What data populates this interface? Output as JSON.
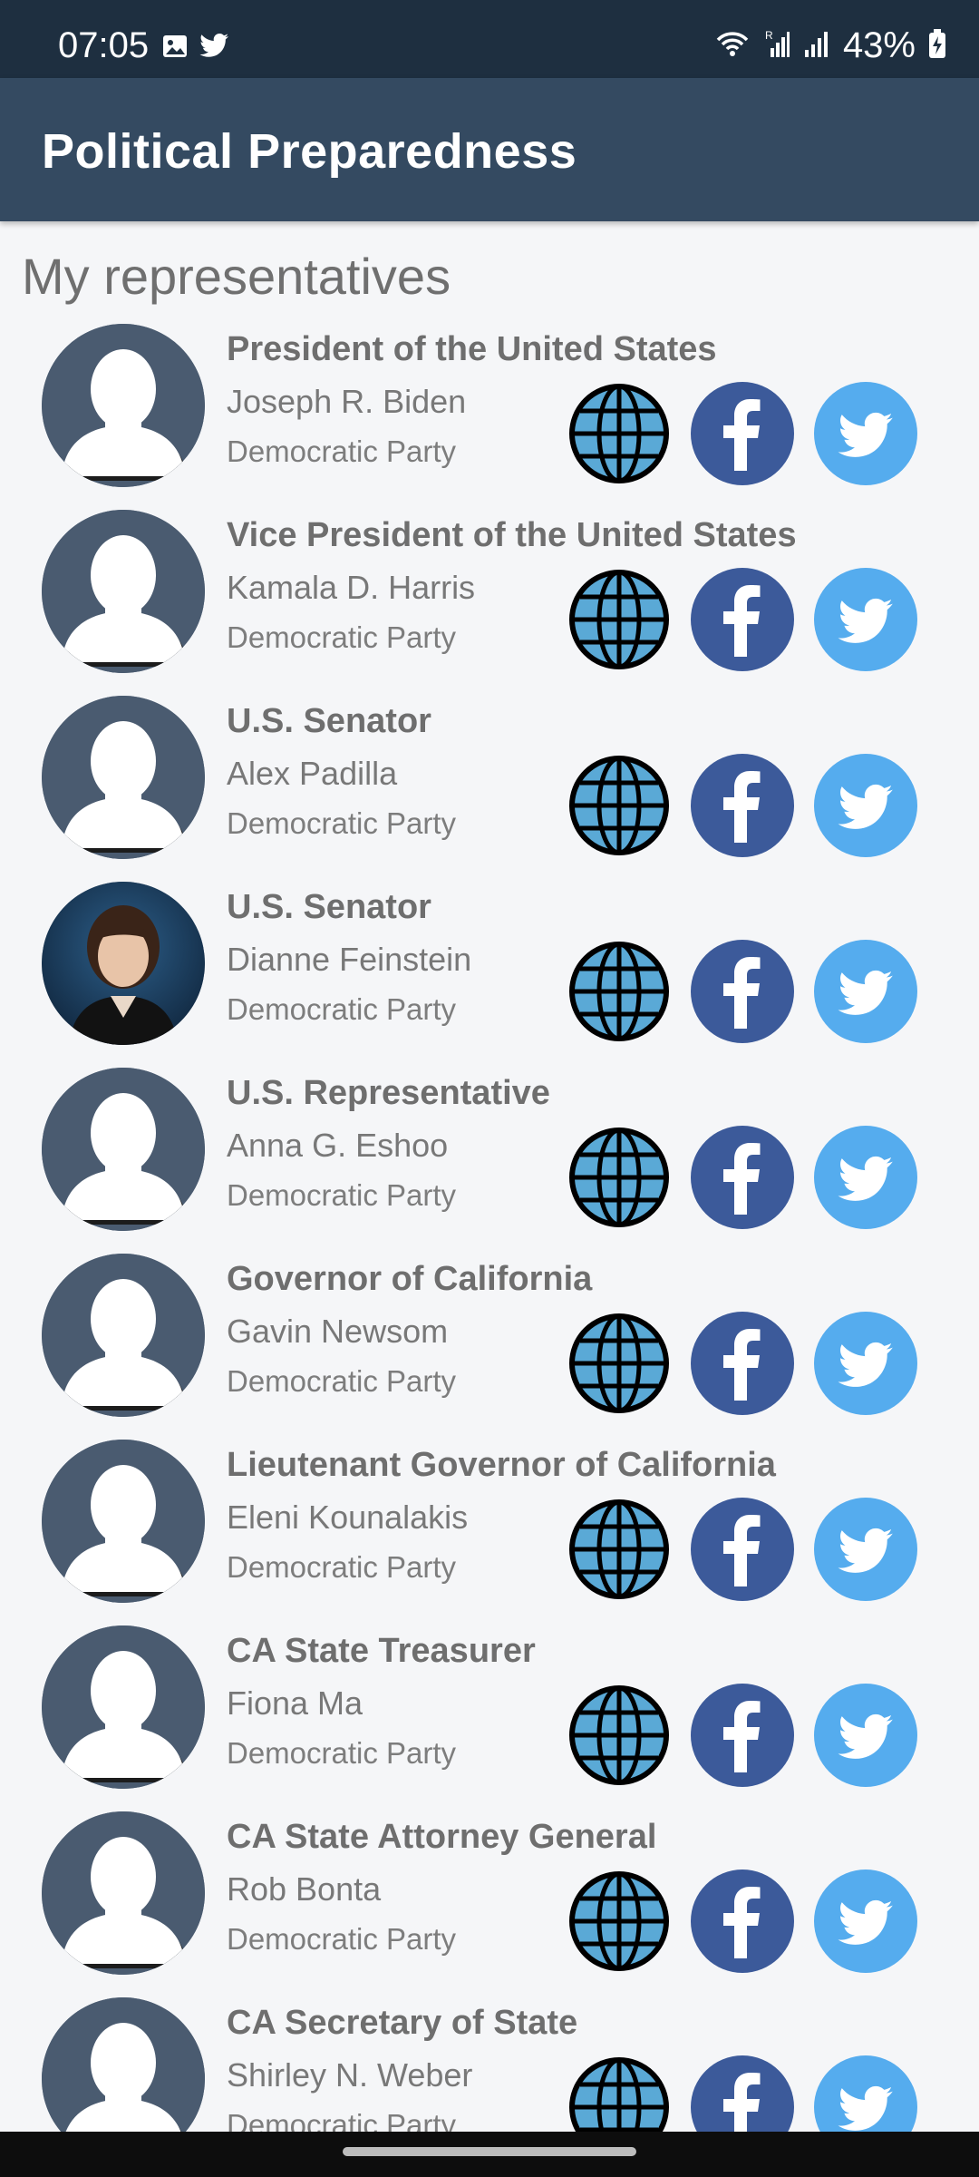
{
  "status_bar": {
    "time": "07:05",
    "battery_percent": "43%",
    "left_icons": [
      "gallery-icon",
      "twitter-notification-icon"
    ],
    "right_icons": [
      "wifi-icon",
      "signal-r-icon",
      "signal-icon",
      "battery-charging-icon"
    ]
  },
  "app_bar": {
    "title": "Political Preparedness"
  },
  "section_title": "My representatives",
  "colors": {
    "status_bar": "#1e2f40",
    "app_bar": "#344a61",
    "avatar_bg": "#4a5b70",
    "facebook": "#3c5a9a",
    "twitter": "#55acee",
    "globe": "#5aa9d6"
  },
  "representatives": [
    {
      "office": "President of the United States",
      "name": "Joseph R. Biden",
      "party": "Democratic Party",
      "photo": "placeholder-avatar"
    },
    {
      "office": "Vice President of the United States",
      "name": "Kamala D. Harris",
      "party": "Democratic Party",
      "photo": "placeholder-avatar"
    },
    {
      "office": "U.S. Senator",
      "name": "Alex Padilla",
      "party": "Democratic Party",
      "photo": "placeholder-avatar"
    },
    {
      "office": "U.S. Senator",
      "name": "Dianne Feinstein",
      "party": "Democratic Party",
      "photo": "portrait-photo"
    },
    {
      "office": "U.S. Representative",
      "name": "Anna G. Eshoo",
      "party": "Democratic Party",
      "photo": "placeholder-avatar"
    },
    {
      "office": "Governor of California",
      "name": "Gavin Newsom",
      "party": "Democratic Party",
      "photo": "placeholder-avatar"
    },
    {
      "office": "Lieutenant Governor of California",
      "name": "Eleni Kounalakis",
      "party": "Democratic Party",
      "photo": "placeholder-avatar"
    },
    {
      "office": "CA State Treasurer",
      "name": "Fiona Ma",
      "party": "Democratic Party",
      "photo": "placeholder-avatar"
    },
    {
      "office": "CA State Attorney General",
      "name": "Rob Bonta",
      "party": "Democratic Party",
      "photo": "placeholder-avatar"
    },
    {
      "office": "CA Secretary of State",
      "name": "Shirley N. Weber",
      "party": "Democratic Party",
      "photo": "placeholder-avatar"
    }
  ]
}
